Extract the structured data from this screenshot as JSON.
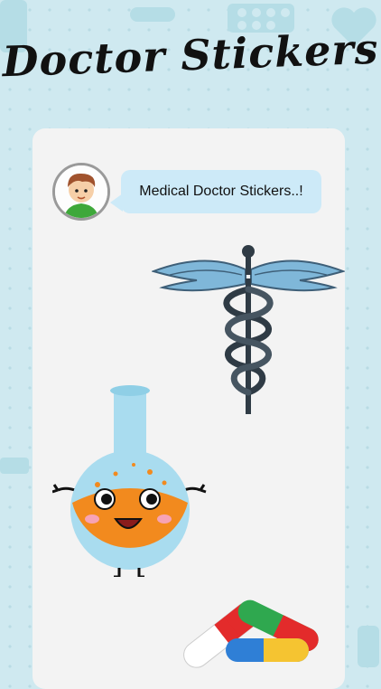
{
  "app": {
    "title": "Doctor Stickers"
  },
  "chat": {
    "message": "Medical Doctor Stickers..!"
  },
  "stickers": [
    {
      "icon": "caduceus-icon"
    },
    {
      "icon": "chemistry-flask-icon"
    },
    {
      "icon": "medicine-capsules-icon"
    }
  ],
  "colors": {
    "background": "#cfe9f0",
    "card": "#f3f3f3",
    "bubble": "#cdeaf8",
    "caduceus_wings": "#7fb7d9",
    "flask_liquid": "#f28a1e"
  }
}
